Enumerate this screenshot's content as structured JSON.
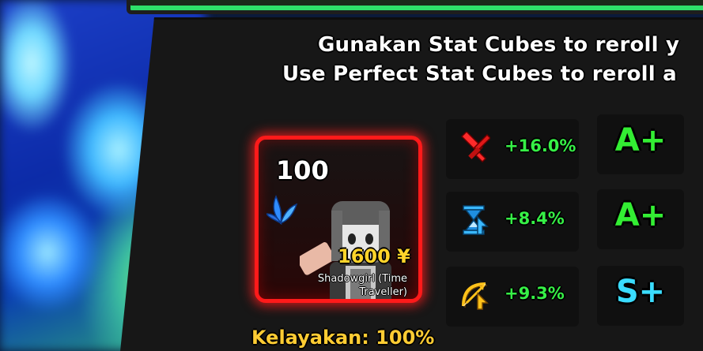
{
  "instructions": {
    "line1": "Gunakan Stat Cubes to reroll y",
    "line2": "Use Perfect Stat Cubes to reroll a"
  },
  "unit": {
    "level": "100",
    "cost": "1600 ¥",
    "name": "Shadowgirl (Time Traveller)",
    "rarity_color": "#ff1a1a",
    "element_icon": "blue-leaf-element-icon"
  },
  "eligibility": "Kelayakan: 100%",
  "stats": [
    {
      "icon": "damage-sword-icon",
      "icon_color": "#ff2a2a",
      "value": "+16.0%",
      "grade": "A+",
      "grade_color": "#33ee33"
    },
    {
      "icon": "hourglass-cooldown-icon",
      "icon_color": "#3ab8ff",
      "value": "+8.4%",
      "grade": "A+",
      "grade_color": "#33ee33"
    },
    {
      "icon": "bow-range-icon",
      "icon_color": "#ffc21a",
      "value": "+9.3%",
      "grade": "S+",
      "grade_color": "#3adcff"
    }
  ],
  "colors": {
    "stat_value": "#36f046",
    "cost": "#ffd42a",
    "eligibility": "#ffcc33"
  }
}
